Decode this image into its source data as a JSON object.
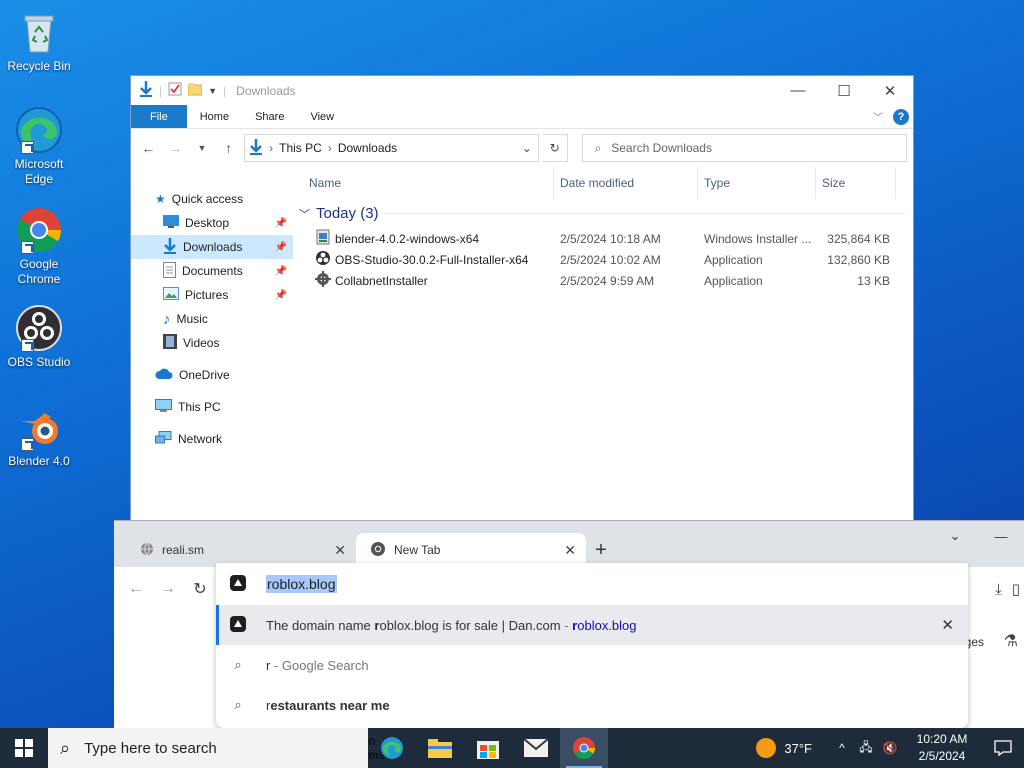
{
  "desktop": {
    "icons": [
      {
        "label": "Recycle Bin"
      },
      {
        "label": "Microsoft Edge"
      },
      {
        "label": "Google Chrome"
      },
      {
        "label": "OBS Studio"
      },
      {
        "label": "Blender 4.0"
      }
    ]
  },
  "explorer": {
    "title": "Downloads",
    "ribbon_tabs": [
      "File",
      "Home",
      "Share",
      "View"
    ],
    "address": {
      "segments": [
        "This PC",
        "Downloads"
      ]
    },
    "search_placeholder": "Search Downloads",
    "nav": {
      "quick_access": "Quick access",
      "items": [
        "Desktop",
        "Downloads",
        "Documents",
        "Pictures",
        "Music",
        "Videos"
      ],
      "onedrive": "OneDrive",
      "this_pc": "This PC",
      "network": "Network"
    },
    "columns": [
      "Name",
      "Date modified",
      "Type",
      "Size"
    ],
    "group": "Today (3)",
    "files": [
      {
        "name": "blender-4.0.2-windows-x64",
        "date": "2/5/2024 10:18 AM",
        "type": "Windows Installer ...",
        "size": "325,864 KB"
      },
      {
        "name": "OBS-Studio-30.0.2-Full-Installer-x64",
        "date": "2/5/2024 10:02 AM",
        "type": "Application",
        "size": "132,860 KB"
      },
      {
        "name": "CollabnetInstaller",
        "date": "2/5/2024 9:59 AM",
        "type": "Application",
        "size": "13 KB"
      }
    ]
  },
  "browser": {
    "tabs": [
      {
        "title": "reali.sm"
      },
      {
        "title": "New Tab"
      }
    ],
    "omnibox": {
      "value": "roblox.blog",
      "suggestions": [
        {
          "prefix": "The domain name ",
          "bold": "r",
          "rest": "oblox.blog is for sale | Dan.com",
          "sep": " - ",
          "url_bold": "r",
          "url_rest": "oblox.blog"
        },
        {
          "text": "r",
          "suffix": " - Google Search"
        },
        {
          "bold": "r",
          "rest": "estaurants near me"
        }
      ]
    },
    "peek_text": "ges"
  },
  "taskbar": {
    "search_placeholder": "Type here to search",
    "weather": "37°F",
    "time": "10:20 AM",
    "date": "2/5/2024",
    "hidden_text": "n ms"
  },
  "colors": {
    "accent": "#1979ca",
    "selection": "#cce8ff",
    "omnibox_highlight": "#a8c7fa"
  }
}
